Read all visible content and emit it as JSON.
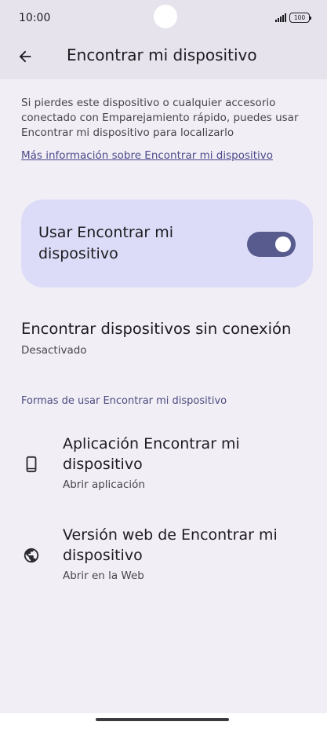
{
  "status_bar": {
    "time": "10:00",
    "battery": "100"
  },
  "app_bar": {
    "title": "Encontrar mi dispositivo"
  },
  "intro": {
    "text": "Si pierdes este dispositivo o cualquier accesorio conectado con Emparejamiento rápido, puedes usar Encontrar mi dispositivo para localizarlo",
    "link": "Más información sobre Encontrar mi dispositivo"
  },
  "toggle": {
    "label": "Usar Encontrar mi dispositivo",
    "checked": true
  },
  "offline": {
    "title": "Encontrar dispositivos sin conexión",
    "status": "Desactivado"
  },
  "section": {
    "header": "Formas de usar Encontrar mi dispositivo"
  },
  "items": [
    {
      "icon": "smartphone-icon",
      "title": "Aplicación Encontrar mi dispositivo",
      "subtitle": "Abrir aplicación"
    },
    {
      "icon": "globe-icon",
      "title": "Versión web de Encontrar mi dispositivo",
      "subtitle": "Abrir en la Web"
    }
  ],
  "colors": {
    "accent": "#575b8d",
    "card": "#dcdcf8",
    "background": "#f2eef6",
    "header": "#e6e3ed"
  }
}
